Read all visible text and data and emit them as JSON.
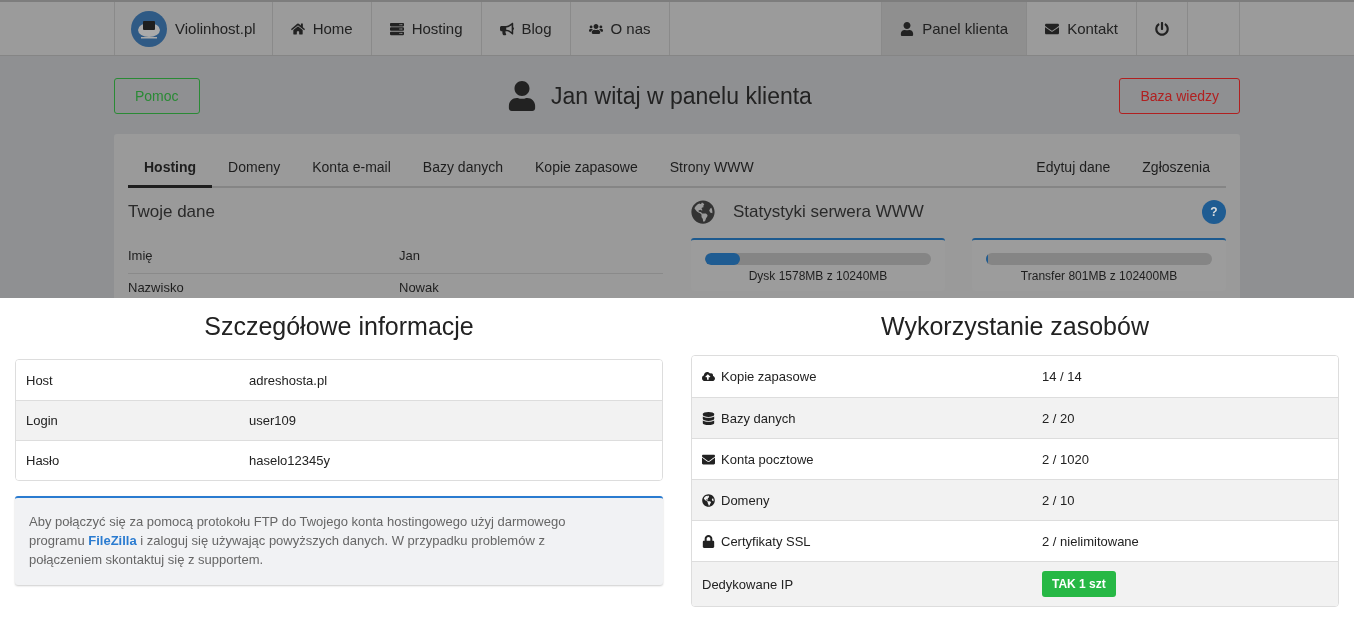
{
  "navbar": {
    "brand": "Violinhost.pl",
    "left_items": [
      {
        "kind": "home",
        "label": "Home",
        "selected": false
      },
      {
        "kind": "hosting",
        "label": "Hosting",
        "selected": false
      },
      {
        "kind": "blog",
        "label": "Blog",
        "selected": false
      },
      {
        "kind": "about",
        "label": "O nas",
        "selected": false
      }
    ],
    "right_items": [
      {
        "kind": "client",
        "label": "Panel klienta",
        "selected": true
      },
      {
        "kind": "contact",
        "label": "Kontakt",
        "selected": false
      },
      {
        "kind": "logout",
        "selected": false
      }
    ]
  },
  "header": {
    "help_button": "Pomoc",
    "title": "Jan witaj w panelu klienta",
    "knowledge_button": "Baza wiedzy"
  },
  "tabs": [
    {
      "label": "Hosting",
      "selected": true
    },
    {
      "label": "Domeny",
      "selected": false
    },
    {
      "label": "Konta e-mail",
      "selected": false
    },
    {
      "label": "Bazy danych",
      "selected": false
    },
    {
      "label": "Kopie zapasowe",
      "selected": false
    },
    {
      "label": "Strony WWW",
      "selected": false
    }
  ],
  "tabs_right": [
    {
      "label": "Edytuj dane",
      "selected": false
    },
    {
      "label": "Zgłoszenia",
      "selected": false
    }
  ],
  "your_data": {
    "title": "Twoje dane",
    "rows": [
      {
        "label": "Imię",
        "value": "Jan"
      },
      {
        "label": "Nazwisko",
        "value": "Nowak"
      }
    ]
  },
  "server_stats": {
    "title": "Statystyki serwera WWW",
    "help": "?",
    "meters": [
      {
        "label": "Dysk 1578MB z 10240MB",
        "level": 0.154
      },
      {
        "label": "Transfer 801MB z 102400MB",
        "level": 0.008
      }
    ]
  },
  "details": {
    "title": "Szczegółowe informacje",
    "rows": [
      {
        "label": "Host",
        "value": "adreshosta.pl"
      },
      {
        "label": "Login",
        "value": "user109"
      },
      {
        "label": "Hasło",
        "value": "haselo12345y"
      }
    ],
    "note": {
      "before": "Aby połączyć się za pomocą protokołu FTP do Twojego konta hostingowego użyj darmowego programu ",
      "link": "FileZilla",
      "after": " i zaloguj się używając powyższych danych. W przypadku problemów z połączeniem skontaktuj się z supportem."
    }
  },
  "resources": {
    "title": "Wykorzystanie zasobów",
    "rows": [
      {
        "kind": "backup",
        "label": "Kopie zapasowe",
        "value": "14 / 14"
      },
      {
        "kind": "database",
        "label": "Bazy danych",
        "value": "2 / 20"
      },
      {
        "kind": "mail",
        "label": "Konta pocztowe",
        "value": "2 / 1020"
      },
      {
        "kind": "domain",
        "label": "Domeny",
        "value": "2 / 10"
      },
      {
        "kind": "ssl",
        "label": "Certyfikaty SSL",
        "value": "2 / nielimitowane"
      },
      {
        "kind": "badge",
        "label": "Dedykowane IP",
        "value": "TAK 1 szt"
      }
    ]
  }
}
